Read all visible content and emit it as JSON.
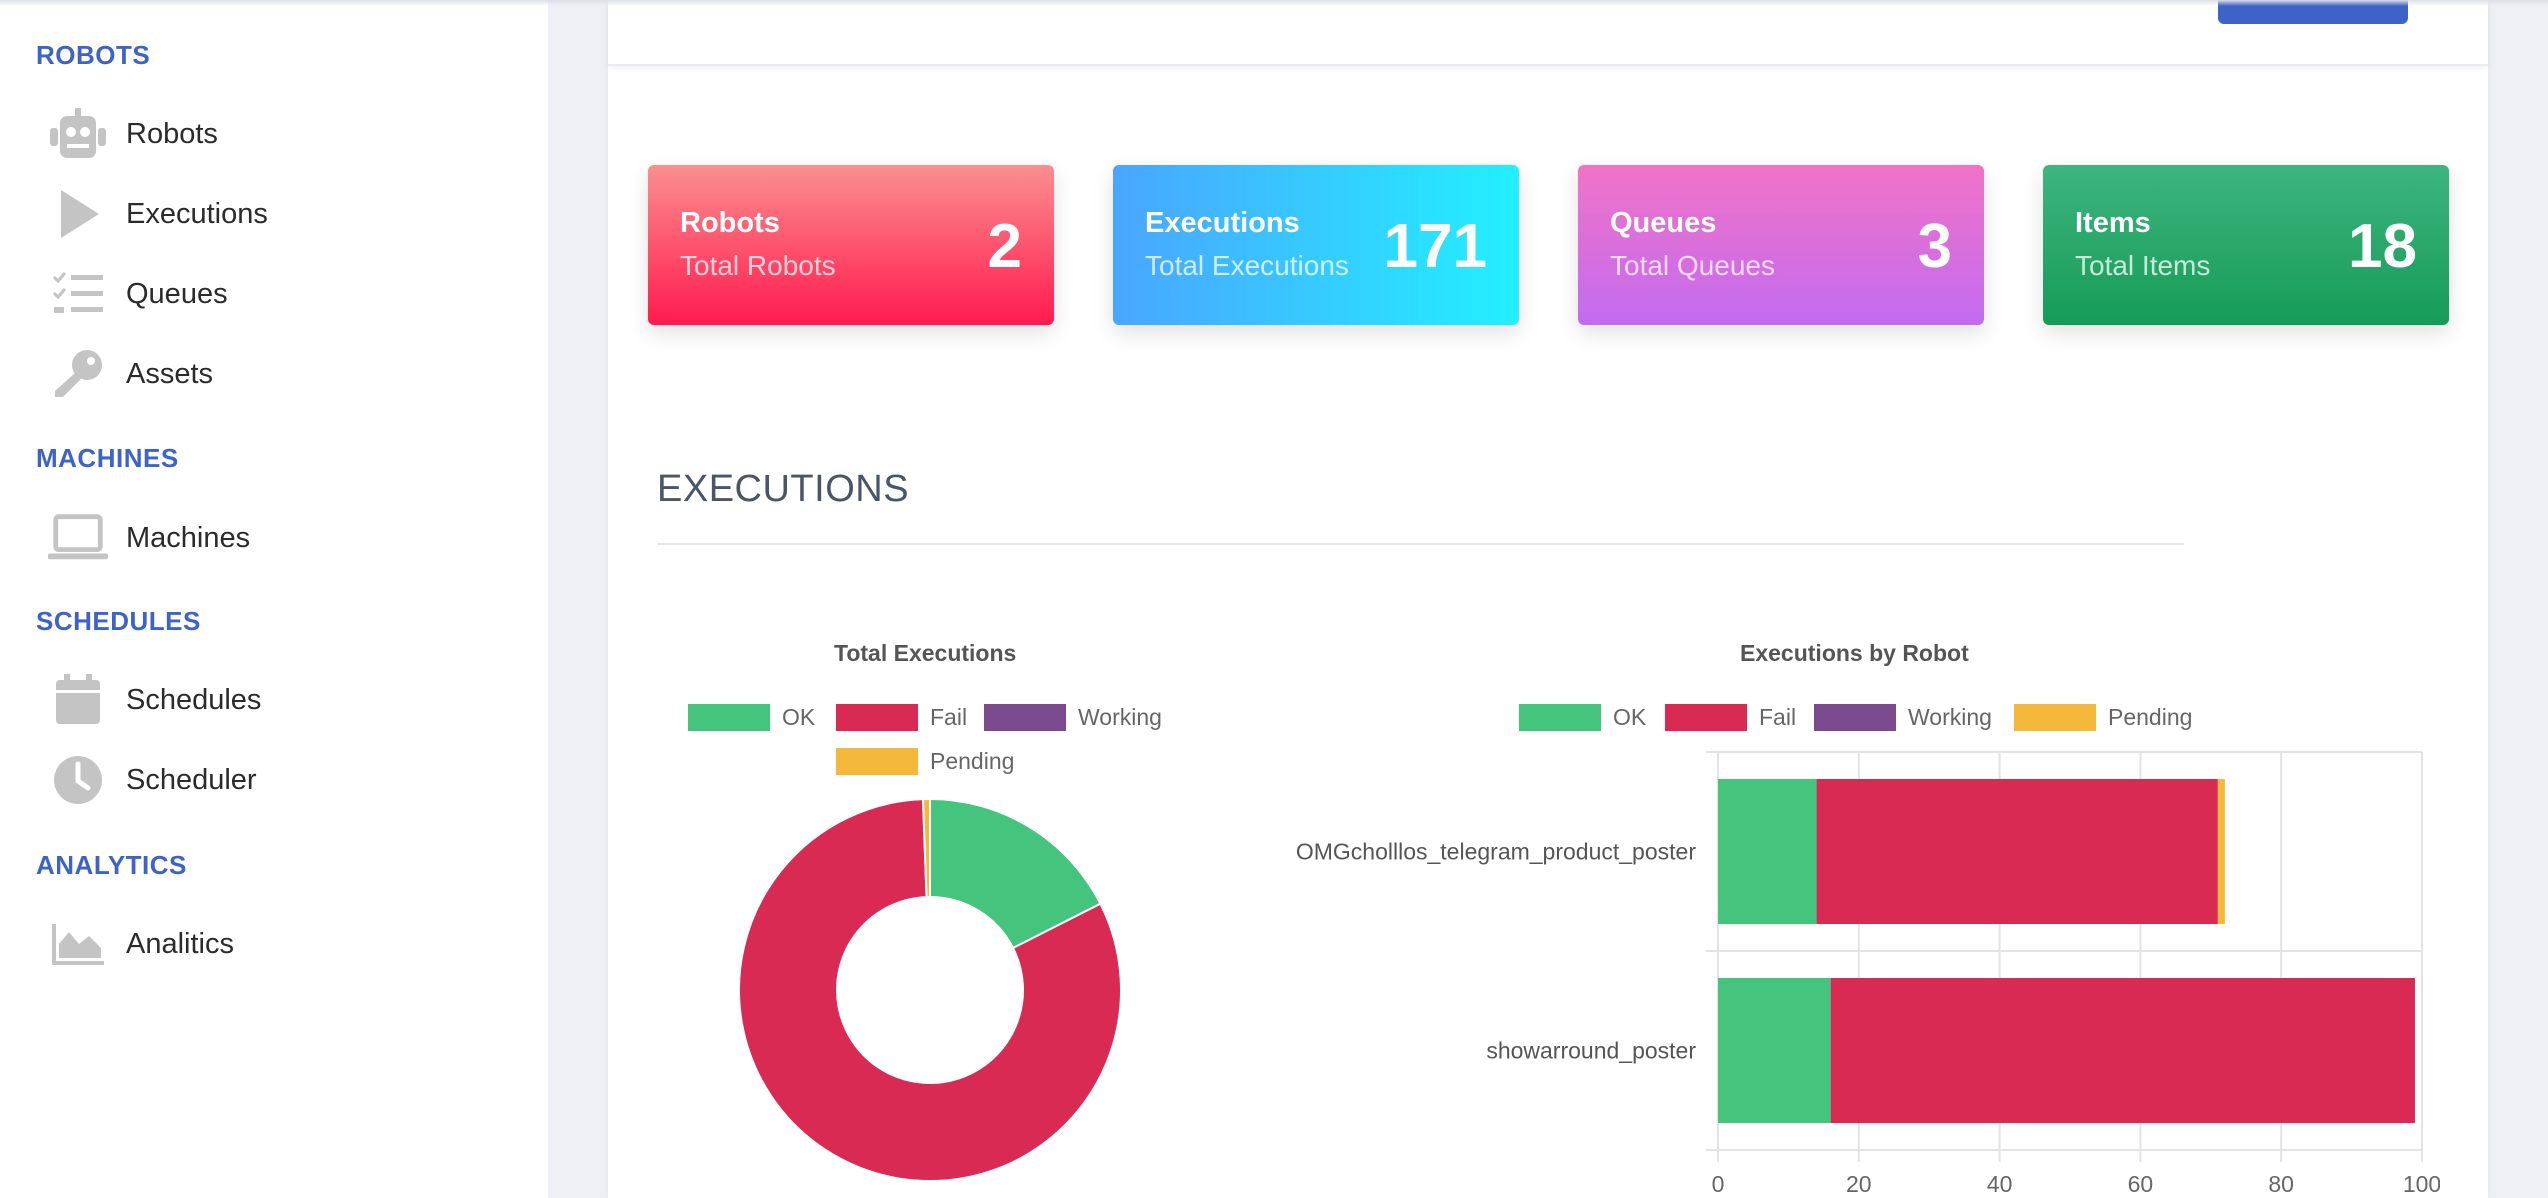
{
  "sidebar": {
    "sections": [
      {
        "title": "ROBOTS",
        "items": [
          {
            "label": "Robots",
            "icon": "robot-icon"
          },
          {
            "label": "Executions",
            "icon": "play-icon"
          },
          {
            "label": "Queues",
            "icon": "checklist-icon"
          },
          {
            "label": "Assets",
            "icon": "key-icon"
          }
        ]
      },
      {
        "title": "MACHINES",
        "items": [
          {
            "label": "Machines",
            "icon": "laptop-icon"
          }
        ]
      },
      {
        "title": "SCHEDULES",
        "items": [
          {
            "label": "Schedules",
            "icon": "calendar-icon"
          },
          {
            "label": "Scheduler",
            "icon": "clock-icon"
          }
        ]
      },
      {
        "title": "ANALYTICS",
        "items": [
          {
            "label": "Analitics",
            "icon": "area-chart-icon"
          }
        ]
      }
    ]
  },
  "stats": [
    {
      "title": "Robots",
      "subtitle": "Total Robots",
      "value": "2"
    },
    {
      "title": "Executions",
      "subtitle": "Total Executions",
      "value": "171"
    },
    {
      "title": "Queues",
      "subtitle": "Total Queues",
      "value": "3"
    },
    {
      "title": "Items",
      "subtitle": "Total Items",
      "value": "18"
    }
  ],
  "executions_heading": "EXECUTIONS",
  "colors": {
    "ok": "#44c47c",
    "fail": "#d82a52",
    "working": "#7b4a8e",
    "pending": "#f4b93a",
    "accent": "#3d63c8"
  },
  "chart_data": [
    {
      "type": "pie",
      "title": "Total Executions",
      "labels": [
        "OK",
        "Fail",
        "Working",
        "Pending"
      ],
      "values": [
        30,
        140,
        0,
        1
      ],
      "legend": "top"
    },
    {
      "type": "bar",
      "orientation": "horizontal",
      "stacked": true,
      "title": "Executions by Robot",
      "categories": [
        "OMGcholllos_telegram_product_poster",
        "showarround_poster"
      ],
      "series": [
        {
          "name": "OK",
          "values": [
            14,
            16
          ]
        },
        {
          "name": "Fail",
          "values": [
            57,
            83
          ]
        },
        {
          "name": "Working",
          "values": [
            0,
            0
          ]
        },
        {
          "name": "Pending",
          "values": [
            1,
            0
          ]
        }
      ],
      "xlim": [
        0,
        100
      ],
      "xticks": [
        "0",
        "20",
        "40",
        "60",
        "80",
        "100"
      ],
      "grid": true,
      "legend": "top"
    }
  ]
}
